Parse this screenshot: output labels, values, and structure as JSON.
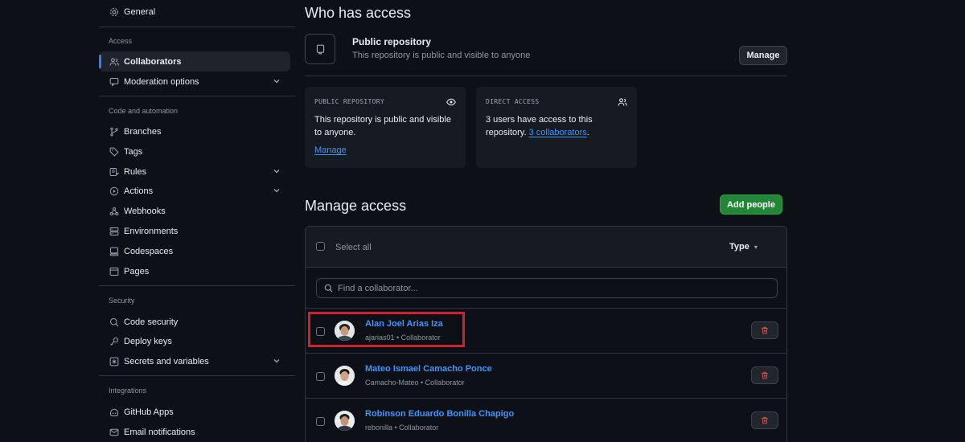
{
  "sidebar": {
    "top_item": {
      "label": "General",
      "icon": "gear-icon"
    },
    "sections": [
      {
        "title": "Access",
        "items": [
          {
            "label": "Collaborators",
            "icon": "people-icon",
            "active": true
          },
          {
            "label": "Moderation options",
            "icon": "comment-icon",
            "expandable": true
          }
        ]
      },
      {
        "title": "Code and automation",
        "items": [
          {
            "label": "Branches",
            "icon": "branch-icon"
          },
          {
            "label": "Tags",
            "icon": "tag-icon"
          },
          {
            "label": "Rules",
            "icon": "rules-icon",
            "expandable": true
          },
          {
            "label": "Actions",
            "icon": "play-icon",
            "expandable": true
          },
          {
            "label": "Webhooks",
            "icon": "webhook-icon"
          },
          {
            "label": "Environments",
            "icon": "server-icon"
          },
          {
            "label": "Codespaces",
            "icon": "codespaces-icon"
          },
          {
            "label": "Pages",
            "icon": "browser-icon"
          }
        ]
      },
      {
        "title": "Security",
        "items": [
          {
            "label": "Code security",
            "icon": "codescan-icon"
          },
          {
            "label": "Deploy keys",
            "icon": "key-icon"
          },
          {
            "label": "Secrets and variables",
            "icon": "asterisk-icon",
            "expandable": true
          }
        ]
      },
      {
        "title": "Integrations",
        "items": [
          {
            "label": "GitHub Apps",
            "icon": "apps-icon"
          },
          {
            "label": "Email notifications",
            "icon": "mail-icon"
          }
        ]
      }
    ]
  },
  "who_has_access": {
    "title": "Who has access",
    "repo_title": "Public repository",
    "repo_subtitle": "This repository is public and visible to anyone",
    "manage_button": "Manage",
    "cards": [
      {
        "heading": "PUBLIC REPOSITORY",
        "text": "This repository is public and visible to anyone.",
        "link": "Manage"
      },
      {
        "heading": "DIRECT ACCESS",
        "text_before": "3 users have access to this repository.",
        "link": "3 collaborators",
        "text_after": "."
      }
    ]
  },
  "manage_access": {
    "title": "Manage access",
    "add_button": "Add people",
    "select_all": "Select all",
    "type_filter": "Type",
    "search_placeholder": "Find a collaborator...",
    "collaborators": [
      {
        "name": "Alan Joel Arias Iza",
        "username": "ajarias01",
        "role": "Collaborator",
        "meta": "ajarias01 • Collaborator"
      },
      {
        "name": "Mateo Ismael Camacho Ponce",
        "username": "Camacho-Mateo",
        "role": "Collaborator",
        "meta": "Camacho-Mateo • Collaborator"
      },
      {
        "name": "Robinson Eduardo Bonilla Chapigo",
        "username": "rebonilla",
        "role": "Collaborator",
        "meta": "rebonilla • Collaborator"
      }
    ]
  },
  "colors": {
    "accent": "#2f81f7",
    "link": "#4493f8",
    "primary_button": "#238636",
    "danger": "#f85149",
    "highlight": "#d0212e"
  }
}
